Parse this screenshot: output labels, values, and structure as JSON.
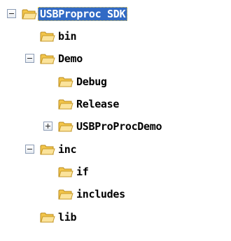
{
  "tree": {
    "nodes": [
      {
        "label": "USBProproc SDK",
        "toggle": "collapse",
        "selected": true
      },
      {
        "label": "bin",
        "toggle": "none",
        "selected": false
      },
      {
        "label": "Demo",
        "toggle": "collapse",
        "selected": false
      },
      {
        "label": "Debug",
        "toggle": "none",
        "selected": false
      },
      {
        "label": "Release",
        "toggle": "none",
        "selected": false
      },
      {
        "label": "USBProProcDemo",
        "toggle": "expand",
        "selected": false
      },
      {
        "label": "inc",
        "toggle": "collapse",
        "selected": false
      },
      {
        "label": "if",
        "toggle": "none",
        "selected": false
      },
      {
        "label": "includes",
        "toggle": "none",
        "selected": false
      },
      {
        "label": "lib",
        "toggle": "none",
        "selected": false
      }
    ]
  },
  "colors": {
    "selection": "#316ac5",
    "folder_body": "#f8d775",
    "folder_front": "#fbe39b",
    "folder_edge": "#c79a28"
  },
  "icons": {
    "folder": "folder-icon",
    "collapse": "minus-box-icon",
    "expand": "plus-box-icon"
  }
}
